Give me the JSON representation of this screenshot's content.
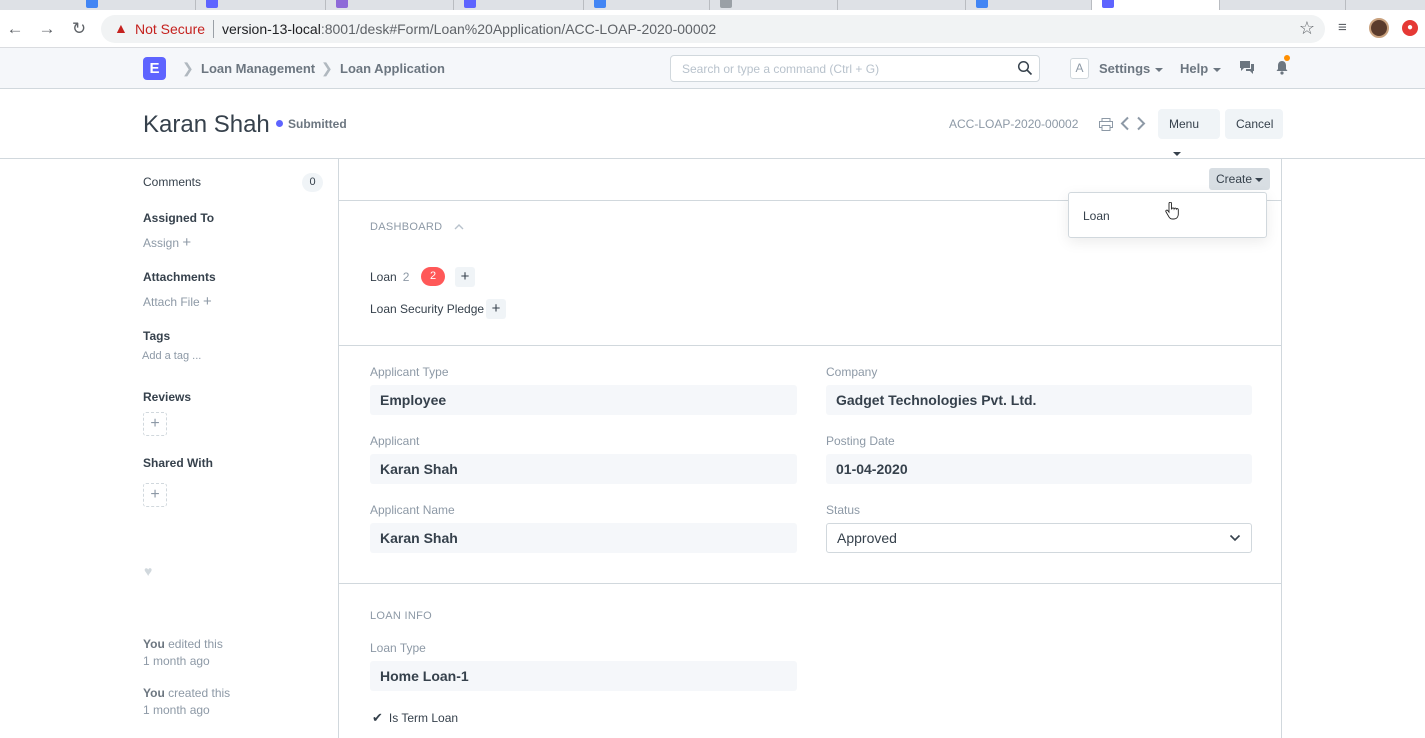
{
  "browser": {
    "security_label": "Not Secure",
    "url_host": "version-13-local",
    "url_rest": ":8001/desk#Form/Loan%20Application/ACC-LOAP-2020-00002"
  },
  "navbar": {
    "breadcrumbs": [
      "Loan Management",
      "Loan Application"
    ],
    "app_logo_letter": "E",
    "search_placeholder": "Search or type a command (Ctrl + G)",
    "avatar_letter": "A",
    "settings_label": "Settings",
    "help_label": "Help"
  },
  "page_head": {
    "title": "Karan Shah",
    "status": "Submitted",
    "doc_name": "ACC-LOAP-2020-00002",
    "menu_label": "Menu",
    "cancel_label": "Cancel"
  },
  "sidebar": {
    "comments_label": "Comments",
    "comments_count": "0",
    "assigned_to_label": "Assigned To",
    "assign_label": "Assign",
    "attachments_label": "Attachments",
    "attach_file_label": "Attach File",
    "tags_label": "Tags",
    "add_tag_label": "Add a tag ...",
    "reviews_label": "Reviews",
    "shared_with_label": "Shared With",
    "activity": [
      {
        "who": "You",
        "what": "edited this",
        "when": "1 month ago"
      },
      {
        "who": "You",
        "what": "created this",
        "when": "1 month ago"
      }
    ]
  },
  "create": {
    "button_label": "Create",
    "menu_items": [
      "Loan"
    ]
  },
  "dashboard": {
    "title": "DASHBOARD",
    "links": [
      {
        "label": "Loan",
        "count": "2",
        "badge": "2"
      },
      {
        "label": "Loan Security Pledge",
        "count": "",
        "badge": ""
      }
    ]
  },
  "fields": {
    "applicant_type": {
      "label": "Applicant Type",
      "value": "Employee"
    },
    "company": {
      "label": "Company",
      "value": "Gadget Technologies Pvt. Ltd."
    },
    "applicant": {
      "label": "Applicant",
      "value": "Karan Shah"
    },
    "posting_date": {
      "label": "Posting Date",
      "value": "01-04-2020"
    },
    "applicant_name": {
      "label": "Applicant Name",
      "value": "Karan Shah"
    },
    "status": {
      "label": "Status",
      "value": "Approved"
    }
  },
  "loan_info": {
    "title": "LOAN INFO",
    "loan_type": {
      "label": "Loan Type",
      "value": "Home Loan-1"
    },
    "is_term_loan_label": "Is Term Loan",
    "is_term_loan_checked": true
  },
  "colors": {
    "accent": "#5e64ff",
    "badge_red": "#ff5858",
    "text": "#36414c",
    "muted": "#8d99a6"
  }
}
